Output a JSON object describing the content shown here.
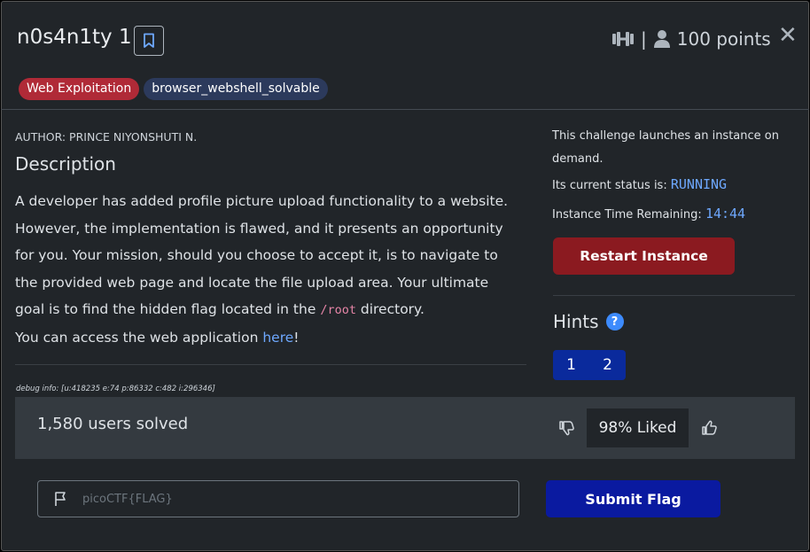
{
  "header": {
    "title": "n0s4n1ty 1",
    "separator": "|",
    "points": "100 points",
    "close_glyph": "✕"
  },
  "tags": [
    "Web Exploitation",
    "browser_webshell_solvable"
  ],
  "tag_colors": {
    "web_exploitation": "#b02a37",
    "browser_webshell_solvable": "#2c3a5c"
  },
  "author": "AUTHOR: PRINCE NIYONSHUTI N.",
  "description": {
    "heading": "Description",
    "text_1": "A developer has added profile picture upload functionality to a website. However, the implementation is flawed, and it presents an opportunity for you. Your mission, should you choose to accept it, is to navigate to the provided web page and locate the file upload area. Your ultimate goal is to find the hidden flag located in the ",
    "code": "/root",
    "text_2": " directory.",
    "access_prefix": "You can access the web application ",
    "access_link": "here",
    "access_suffix": "!"
  },
  "debug_info": "debug info: [u:418235 e:74 p:86332 c:482 i:296346]",
  "instance": {
    "intro": "This challenge launches an instance on demand.",
    "status_label": "Its current status is:",
    "status_value": "RUNNING",
    "time_label": "Instance Time Remaining:",
    "time_value": "14:44",
    "restart_label": "Restart Instance"
  },
  "hints": {
    "heading": "Hints",
    "help_glyph": "?",
    "items": [
      "1",
      "2"
    ]
  },
  "stats": {
    "solved": "1,580 users solved",
    "liked": "98% Liked"
  },
  "flag_form": {
    "placeholder": "picoCTF{FLAG}",
    "submit_label": "Submit Flag"
  },
  "icons": {
    "bookmark": "bookmark-icon",
    "difficulty": "dumbbell-icon",
    "user": "user-icon",
    "thumbs_down": "thumbs-down-icon",
    "thumbs_up": "thumbs-up-icon",
    "flag": "flag-icon"
  },
  "colors": {
    "accent_blue": "#6ea8fe",
    "restart_red": "#8b1a20",
    "submit_blue": "#0a1aa0",
    "hint_blue": "#0a2a9c"
  }
}
